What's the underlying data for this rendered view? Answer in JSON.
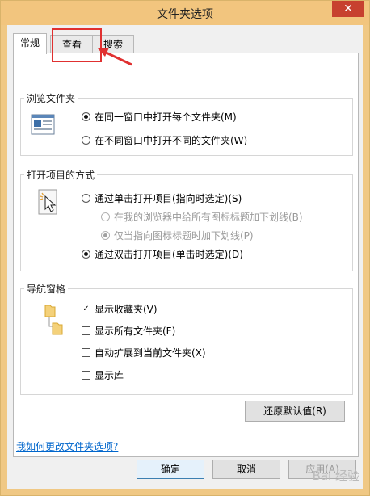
{
  "window": {
    "title": "文件夹选项",
    "close_symbol": "✕"
  },
  "tabs": [
    {
      "label": "常规",
      "active": true
    },
    {
      "label": "查看",
      "active": false
    },
    {
      "label": "搜索",
      "active": false
    }
  ],
  "browse": {
    "title": "浏览文件夹",
    "options": [
      {
        "label": "在同一窗口中打开每个文件夹(M)",
        "checked": true
      },
      {
        "label": "在不同窗口中打开不同的文件夹(W)",
        "checked": false
      }
    ]
  },
  "click": {
    "title": "打开项目的方式",
    "single": "通过单击打开项目(指向时选定)(S)",
    "sub1": "在我的浏览器中给所有图标标题加下划线(B)",
    "sub2": "仅当指向图标标题时加下划线(P)",
    "double": "通过双击打开项目(单击时选定)(D)"
  },
  "nav": {
    "title": "导航窗格",
    "items": [
      {
        "label": "显示收藏夹(V)",
        "checked": true,
        "mark": "✓"
      },
      {
        "label": "显示所有文件夹(F)",
        "checked": false
      },
      {
        "label": "自动扩展到当前文件夹(X)",
        "checked": false
      },
      {
        "label": "显示库",
        "checked": false
      }
    ]
  },
  "restore_label": "还原默认值(R)",
  "help_link": "我如何更改文件夹选项?",
  "buttons": {
    "ok": "确定",
    "cancel": "取消",
    "apply": "应用(A)"
  },
  "watermark": "Bai 经验",
  "accent_colors": {
    "title_bar": "#f2c57e",
    "close": "#c7412f",
    "link": "#0066cc",
    "highlight": "#e03030"
  }
}
